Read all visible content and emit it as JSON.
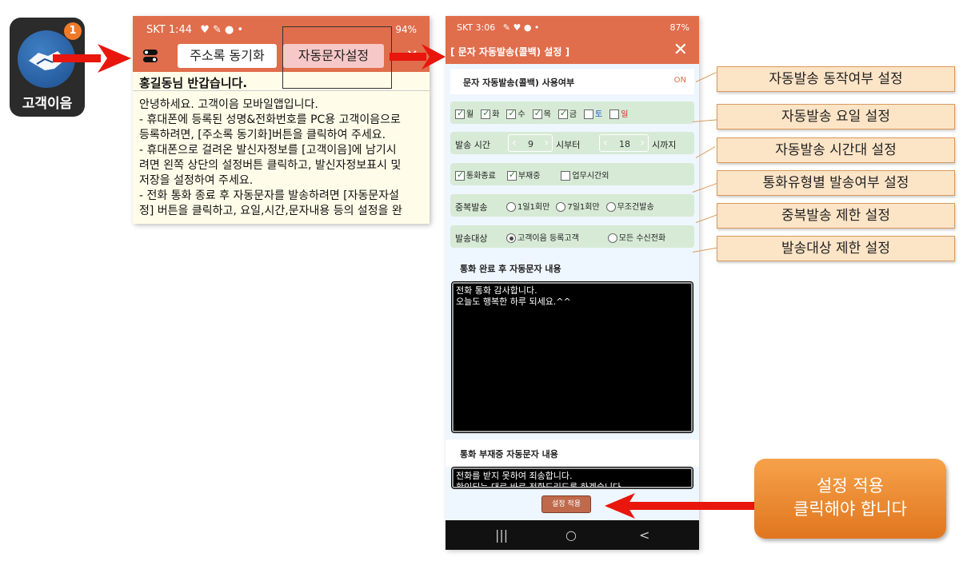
{
  "app_icon": {
    "label": "고객이음",
    "badge": "1"
  },
  "phone1": {
    "status_time": "SKT 1:44",
    "status_right": "94%",
    "sync_button": "주소록 동기화",
    "auto_button": "자동문자설정",
    "greeting": "홍길동님 반갑습니다.",
    "body_lines": [
      "안녕하세요. 고객이음 모바일앱입니다.",
      "- 휴대폰에 등록된 성명&전화번호를 PC용 고객이음으로",
      "등록하려면, [주소록 동기화]버튼을 클릭하여 주세요.",
      "- 휴대폰으로 걸려온 발신자정보를 [고객이음]에 남기시",
      "려면 왼쪽 상단의 설정버튼 클릭하고, 발신자정보표시 및",
      "저장을 설정하여 주세요.",
      "- 전화 통화 종료 후 자동문자를 발송하려면 [자동문자설",
      "정] 버튼을 클릭하고, 요일,시간,문자내용 등의 설정을 완"
    ]
  },
  "phone2": {
    "status_time": "SKT 3:06",
    "status_right": "87%",
    "header_title": "[ 문자 자동발송(콜백) 설정 ]",
    "usage_label": "문자 자동발송(콜백) 사용여부",
    "usage_value": "ON",
    "days": [
      {
        "label": "월",
        "checked": true,
        "color": "#222222"
      },
      {
        "label": "화",
        "checked": true,
        "color": "#222222"
      },
      {
        "label": "수",
        "checked": true,
        "color": "#222222"
      },
      {
        "label": "목",
        "checked": true,
        "color": "#222222"
      },
      {
        "label": "금",
        "checked": true,
        "color": "#222222"
      },
      {
        "label": "토",
        "checked": false,
        "color": "#1f5fd6"
      },
      {
        "label": "일",
        "checked": false,
        "color": "#d62828"
      }
    ],
    "time_label": "발송 시간",
    "time_start": "9",
    "time_from": "시부터",
    "time_end": "18",
    "time_to": "시까지",
    "call_types": [
      {
        "label": "통화종료",
        "checked": true
      },
      {
        "label": "부재중",
        "checked": true
      },
      {
        "label": "업무시간외",
        "checked": false
      }
    ],
    "dup_label": "중복발송",
    "dup_options": [
      {
        "label": "1일1회만",
        "selected": false
      },
      {
        "label": "7일1회만",
        "selected": false
      },
      {
        "label": "무조건발송",
        "selected": false
      }
    ],
    "target_label": "발송대상",
    "target_options": [
      {
        "label": "고객이음 등록고객",
        "selected": true
      },
      {
        "label": "모든 수신전화",
        "selected": false
      }
    ],
    "done_title": "통화 완료 후 자동문자 내용",
    "done_text_1": "전화 통화 감사합니다.",
    "done_text_2": "오늘도 행복한 하루 되세요.^^",
    "missed_title": "통화 부재중 자동문자 내용",
    "missed_text_1": "전화를 받지 못하여 죄송합니다.",
    "missed_text_2": "확인되는 대로 바로 전화드리도록 하겠습니다.",
    "apply_button": "설정 적용",
    "nav": [
      "|||",
      "○",
      "<"
    ]
  },
  "callouts": [
    "자동발송 동작여부 설정",
    "자동발송 요일 설정",
    "자동발송 시간대 설정",
    "통화유형별 발송여부 설정",
    "중복발송 제한 설정",
    "발송대상 제한 설정"
  ],
  "big_callout": {
    "line1": "설정 적용",
    "line2": "클릭해야 합니다"
  },
  "colors": {
    "accent": "#e06d4c",
    "callout_bg": "#fce4c6",
    "arrow": "#e8160c",
    "row_green": "#d7ead6"
  }
}
